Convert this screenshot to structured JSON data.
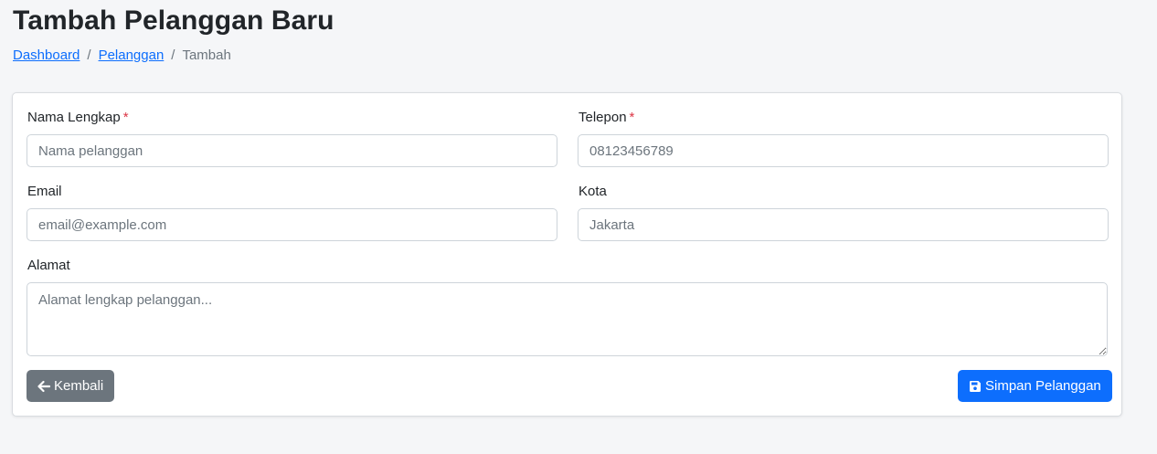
{
  "page": {
    "title": "Tambah Pelanggan Baru"
  },
  "breadcrumb": {
    "items": [
      {
        "label": "Dashboard"
      },
      {
        "label": "Pelanggan"
      },
      {
        "label": "Tambah"
      }
    ],
    "separator": "/"
  },
  "form": {
    "nama": {
      "label": "Nama Lengkap",
      "required_mark": "*",
      "value": "",
      "placeholder": "Nama pelanggan"
    },
    "telepon": {
      "label": "Telepon",
      "required_mark": "*",
      "value": "",
      "placeholder": "08123456789"
    },
    "email": {
      "label": "Email",
      "value": "",
      "placeholder": "email@example.com"
    },
    "kota": {
      "label": "Kota",
      "value": "",
      "placeholder": "Jakarta"
    },
    "alamat": {
      "label": "Alamat",
      "value": "",
      "placeholder": "Alamat lengkap pelanggan..."
    }
  },
  "actions": {
    "back_label": "Kembali",
    "back_icon": "arrow-left-icon",
    "save_label": "Simpan Pelanggan",
    "save_icon": "floppy-disk-icon"
  },
  "colors": {
    "primary": "#0d6efd",
    "secondary": "#6c757d",
    "required": "#dc3545",
    "background": "#f5f6f8"
  }
}
